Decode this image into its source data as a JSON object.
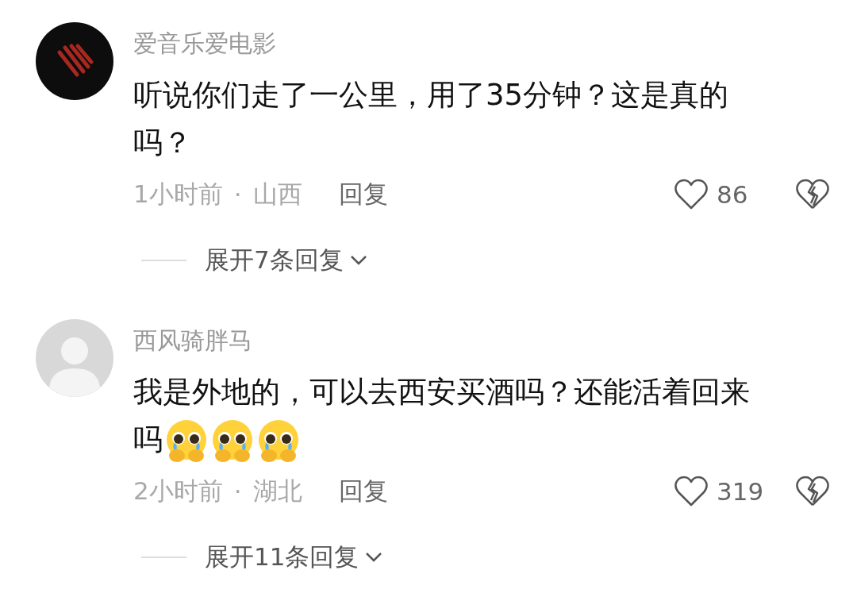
{
  "comments": [
    {
      "avatar": {
        "kind": "claw"
      },
      "username": "爱音乐爱电影",
      "text": "听说你们走了一公里，用了35分钟？这是真的吗？",
      "time": "1小时前",
      "separator": "·",
      "location": "山西",
      "reply": "回复",
      "likes": "86",
      "expand": "展开7条回复"
    },
    {
      "avatar": {
        "kind": "default"
      },
      "username": "西风骑胖马",
      "text": "我是外地的，可以去西安买酒吗？还能活着回来吗",
      "emojis": [
        {
          "kind": "crying"
        },
        {
          "kind": "crying"
        },
        {
          "kind": "crying"
        }
      ],
      "time": "2小时前",
      "separator": "·",
      "location": "湖北",
      "reply": "回复",
      "likes": "319",
      "expand": "展开11条回复"
    }
  ]
}
